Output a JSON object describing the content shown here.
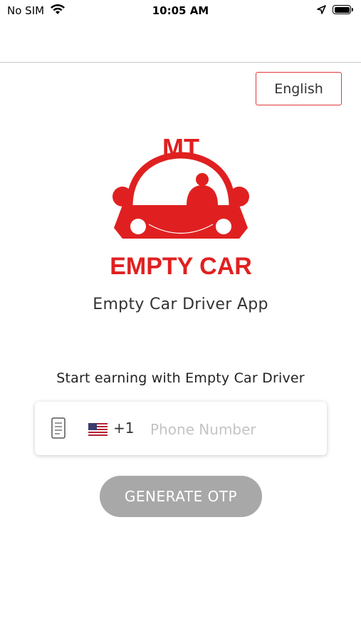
{
  "status_bar": {
    "carrier": "No SIM",
    "time": "10:05 AM"
  },
  "language": {
    "label": "English"
  },
  "logo": {
    "top_text": "MT",
    "bottom_text": "EMPTY CAR",
    "brand_color": "#e02020"
  },
  "app": {
    "title": "Empty Car Driver App"
  },
  "login": {
    "tagline": "Start earning with Empty Car Driver",
    "country_code": "+1",
    "phone_placeholder": "Phone Number",
    "phone_value": "",
    "button_label": "GENERATE OTP"
  },
  "colors": {
    "accent_red": "#e03a3a",
    "button_disabled": "#a8a8a8"
  },
  "icons": {
    "flag": "us-flag-icon",
    "document": "document-icon"
  }
}
